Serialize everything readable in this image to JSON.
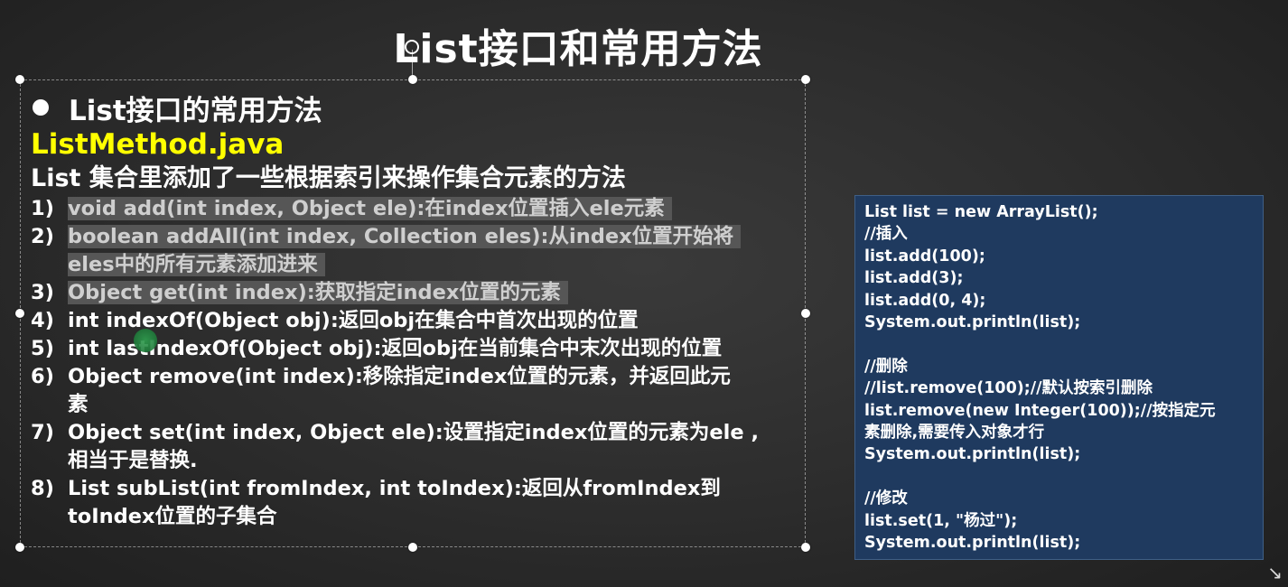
{
  "slide": {
    "title": "List接口和常用方法"
  },
  "section": {
    "heading": "List接口的常用方法",
    "file_name": "ListMethod.java",
    "intro": "List 集合里添加了一些根据索引来操作集合元素的方法"
  },
  "methods": [
    {
      "num": "1)",
      "highlighted": true,
      "lines": [
        "void add(int index, Object ele):在index位置插入ele元素"
      ]
    },
    {
      "num": "2)",
      "highlighted": true,
      "lines": [
        "boolean addAll(int index, Collection eles):从index位置开始将",
        "eles中的所有元素添加进来"
      ]
    },
    {
      "num": "3)",
      "highlighted": true,
      "lines": [
        "Object get(int index):获取指定index位置的元素"
      ]
    },
    {
      "num": "4)",
      "highlighted": false,
      "lines": [
        "int indexOf(Object obj):返回obj在集合中首次出现的位置"
      ]
    },
    {
      "num": "5)",
      "highlighted": false,
      "lines": [
        "int lastIndexOf(Object obj):返回obj在当前集合中末次出现的位置"
      ]
    },
    {
      "num": "6)",
      "highlighted": false,
      "lines": [
        "Object remove(int index):移除指定index位置的元素，并返回此元",
        "素"
      ]
    },
    {
      "num": "7)",
      "highlighted": false,
      "lines": [
        "Object set(int index, Object ele):设置指定index位置的元素为ele ,",
        "相当于是替换."
      ]
    },
    {
      "num": "8)",
      "highlighted": false,
      "lines": [
        "List subList(int fromIndex, int toIndex):返回从fromIndex到",
        "toIndex位置的子集合"
      ]
    }
  ],
  "code": {
    "lines": [
      "List list = new ArrayList();",
      "//插入",
      "list.add(100);",
      "list.add(3);",
      "list.add(0, 4);",
      "System.out.println(list);",
      "",
      "//删除",
      "//list.remove(100);//默认按索引删除",
      "list.remove(new Integer(100));//按指定元",
      "素删除,需要传入对象才行",
      "System.out.println(list);",
      "",
      "//修改",
      "list.set(1, \"杨过\");",
      "System.out.println(list);"
    ]
  },
  "icons": {
    "bullet": "bullet-dot-icon",
    "rotate": "rotate-handle-icon",
    "cursor": "pointer-cursor-icon"
  },
  "colors": {
    "title_text": "#ffffff",
    "file_name": "#ffff00",
    "highlight_bg": "#565656",
    "code_panel_bg": "#1f3a5f"
  }
}
